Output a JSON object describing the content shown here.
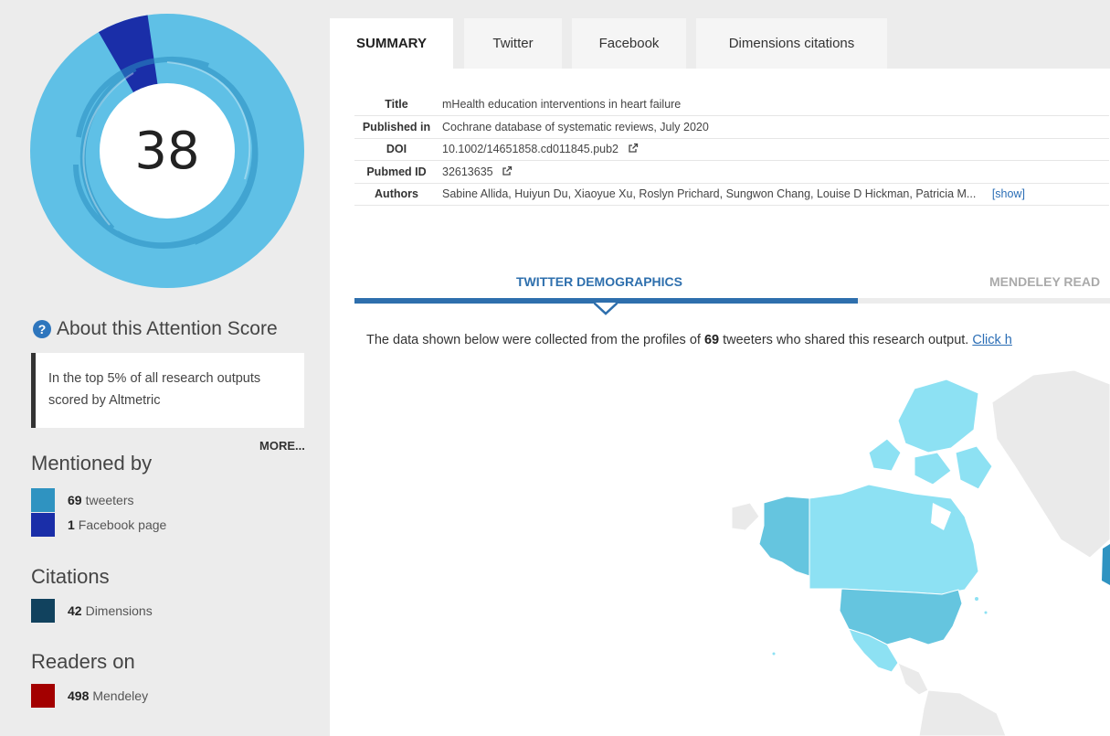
{
  "colors": {
    "twitter": "#2f93c1",
    "facebook": "#1a2ea8",
    "dimensions": "#11425e",
    "mendeley": "#a30000",
    "accent": "#2e6fad"
  },
  "score": {
    "value": "38",
    "about_label": "About this Attention Score",
    "about_icon": "question-circle-icon",
    "rank_text": "In the top 5% of all research outputs scored by Altmetric",
    "more_label": "MORE..."
  },
  "mentioned_by": {
    "heading": "Mentioned by",
    "items": [
      {
        "count": "69",
        "label": "tweeters"
      },
      {
        "count": "1",
        "label": "Facebook page"
      }
    ]
  },
  "citations": {
    "heading": "Citations",
    "items": [
      {
        "count": "42",
        "label": "Dimensions"
      }
    ]
  },
  "readers": {
    "heading": "Readers on",
    "items": [
      {
        "count": "498",
        "label": "Mendeley"
      }
    ]
  },
  "tabs": [
    {
      "label": "SUMMARY",
      "active": true
    },
    {
      "label": "Twitter"
    },
    {
      "label": "Facebook"
    },
    {
      "label": "Dimensions citations"
    }
  ],
  "details": {
    "title_label": "Title",
    "title": "mHealth education interventions in heart failure",
    "published_label": "Published in",
    "published": "Cochrane database of systematic reviews, July 2020",
    "doi_label": "DOI",
    "doi": "10.1002/14651858.cd011845.pub2",
    "pubmed_label": "Pubmed ID",
    "pubmed": "32613635",
    "authors_label": "Authors",
    "authors": "Sabine Allida, Huiyun Du, Xiaoyue Xu, Roslyn Prichard, Sungwon Chang, Louise D Hickman, Patricia M...",
    "show_label": "[show]"
  },
  "demographics": {
    "tab_twitter": "TWITTER DEMOGRAPHICS",
    "tab_mendeley": "MENDELEY READ",
    "text_before": "The data shown below were collected from the profiles of ",
    "count": "69",
    "text_after": " tweeters who shared this research output. ",
    "link": "Click h"
  }
}
